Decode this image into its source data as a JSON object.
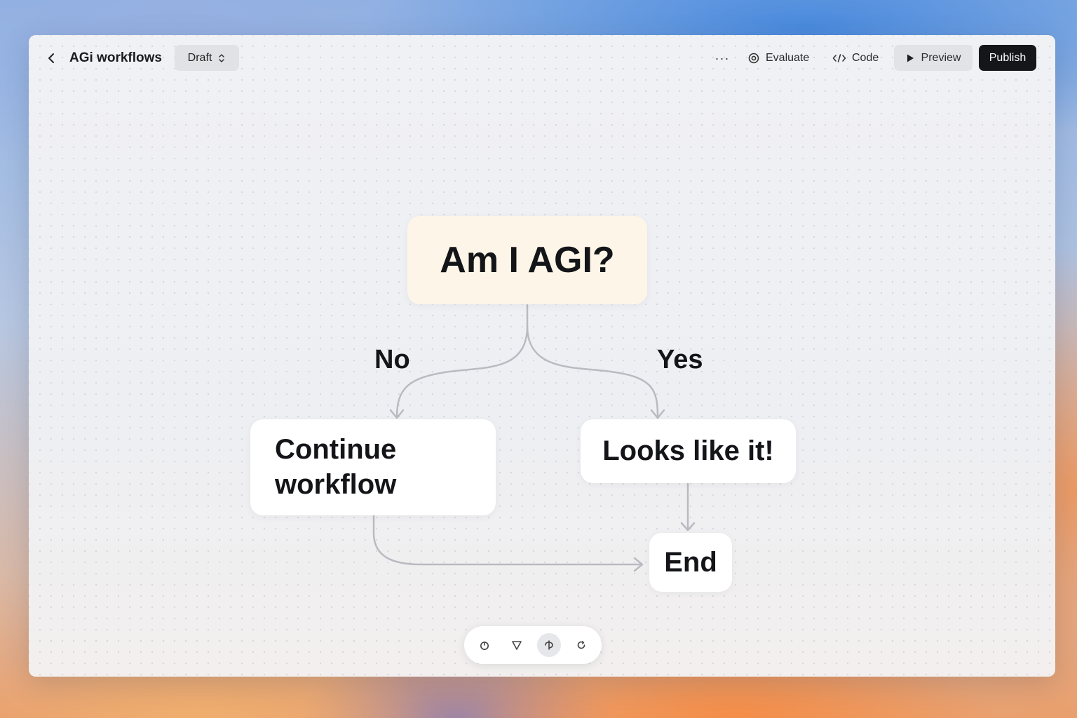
{
  "app": {
    "title": "AGi workflows",
    "status": "Draft"
  },
  "toolbar": {
    "more_label": "···",
    "evaluate_label": "Evaluate",
    "code_label": "Code",
    "preview_label": "Preview",
    "publish_label": "Publish"
  },
  "workflow": {
    "start_node": "Am I AGI?",
    "branch_no_label": "No",
    "branch_yes_label": "Yes",
    "no_node": "Continue workflow",
    "yes_node": "Looks like it!",
    "end_node": "End"
  },
  "canvas_tools": [
    {
      "icon": "pointer-icon"
    },
    {
      "icon": "triangle-icon"
    },
    {
      "icon": "pan-icon",
      "active": true
    },
    {
      "icon": "refresh-icon"
    }
  ],
  "colors": {
    "publish_bg": "#15161a",
    "start_node_bg": "#fdf6e8",
    "edge": "#b9bbc1"
  }
}
